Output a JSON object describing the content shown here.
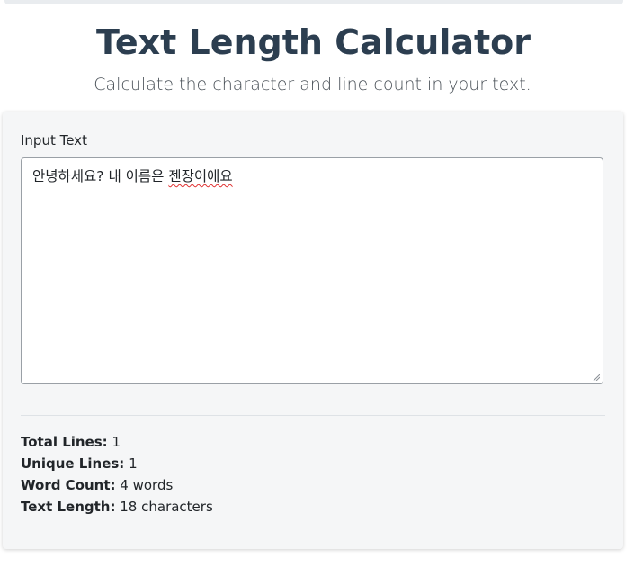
{
  "header": {
    "title": "Text Length Calculator",
    "subtitle": "Calculate the character and line count in your text."
  },
  "input": {
    "label": "Input Text",
    "value_plain": "안녕하세요? 내 이름은 ",
    "value_misspelled": "젠장이에요"
  },
  "stats": {
    "total_lines_label": "Total Lines:",
    "total_lines_value": "1",
    "unique_lines_label": "Unique Lines:",
    "unique_lines_value": "1",
    "word_count_label": "Word Count:",
    "word_count_value": "4 words",
    "text_length_label": "Text Length:",
    "text_length_value": "18 characters"
  },
  "colors": {
    "title": "#2c3e50",
    "card_background": "#f5f6f7",
    "spellcheck_underline": "#e03131"
  }
}
